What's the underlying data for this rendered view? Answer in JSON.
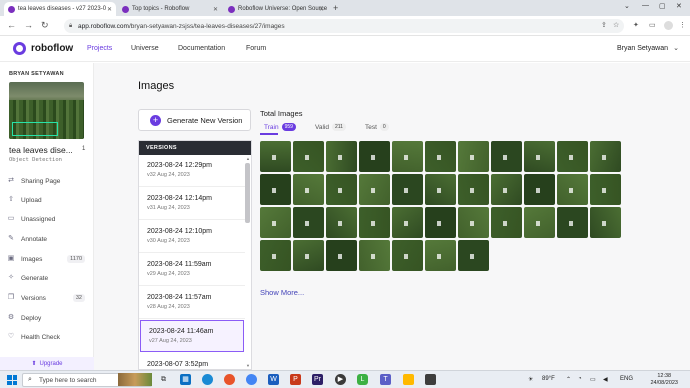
{
  "browser": {
    "tabs": [
      {
        "label": "tea leaves diseases - v27 2023-0"
      },
      {
        "label": "Top topics - Roboflow"
      },
      {
        "label": "Roboflow Universe: Open Source"
      }
    ],
    "url_host": "app.roboflow.com",
    "url_path": "/bryan-setyawan-zsjss/tea-leaves-diseases/27/images"
  },
  "header": {
    "logo": "roboflow",
    "nav": [
      "Projects",
      "Universe",
      "Documentation",
      "Forum"
    ],
    "user": "Bryan Setyawan"
  },
  "sidebar": {
    "owner": "BRYAN SETYAWAN",
    "project_name": "tea leaves dise...",
    "project_badge": "1",
    "project_type": "Object Detection",
    "items": [
      {
        "label": "Sharing Page",
        "icon": "share-icon",
        "count": ""
      },
      {
        "label": "Upload",
        "icon": "upload-icon",
        "count": ""
      },
      {
        "label": "Unassigned",
        "icon": "inbox-icon",
        "count": ""
      },
      {
        "label": "Annotate",
        "icon": "pen-icon",
        "count": ""
      },
      {
        "label": "Images",
        "icon": "image-icon",
        "count": "1170"
      },
      {
        "label": "Generate",
        "icon": "generate-icon",
        "count": ""
      },
      {
        "label": "Versions",
        "icon": "versions-icon",
        "count": "32"
      },
      {
        "label": "Deploy",
        "icon": "deploy-icon",
        "count": ""
      },
      {
        "label": "Health Check",
        "icon": "health-icon",
        "count": ""
      }
    ],
    "upgrade": "Upgrade"
  },
  "main": {
    "title": "Images",
    "generate_label": "Generate New Version",
    "versions_header": "VERSIONS",
    "versions": [
      {
        "title": "2023-08-24 12:29pm",
        "sub": "v32 Aug 24, 2023"
      },
      {
        "title": "2023-08-24 12:14pm",
        "sub": "v31 Aug 24, 2023"
      },
      {
        "title": "2023-08-24 12:10pm",
        "sub": "v30 Aug 24, 2023"
      },
      {
        "title": "2023-08-24 11:59am",
        "sub": "v29 Aug 24, 2023"
      },
      {
        "title": "2023-08-24 11:57am",
        "sub": "v28 Aug 24, 2023"
      },
      {
        "title": "2023-08-24 11:46am",
        "sub": "v27 Aug 24, 2023"
      },
      {
        "title": "2023-08-07 3:52pm",
        "sub": ""
      }
    ],
    "selected_version_index": 5,
    "total_images_label": "Total Images",
    "splits": [
      {
        "label": "Train",
        "count": "959"
      },
      {
        "label": "Valid",
        "count": "211"
      },
      {
        "label": "Test",
        "count": "0"
      }
    ],
    "thumbnail_count": 40,
    "show_more": "Show More..."
  },
  "taskbar": {
    "search_placeholder": "Type here to search",
    "weather": "89°F",
    "lang": "ENG",
    "time": "12:38",
    "date": "24/08/2023"
  }
}
